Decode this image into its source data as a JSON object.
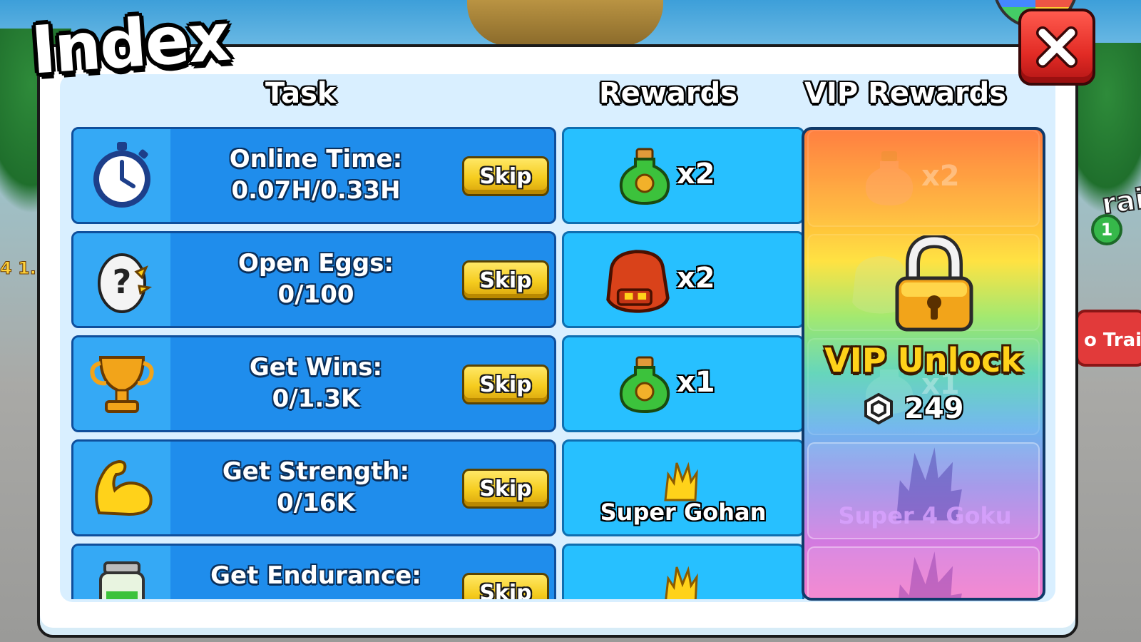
{
  "window": {
    "title": "Index",
    "close_icon": "close-x-icon"
  },
  "columns": {
    "task": "Task",
    "rewards": "Rewards",
    "vip_rewards": "VIP Rewards"
  },
  "rows": [
    {
      "task_label": "Online Time:",
      "task_value": "0.07H/0.33H",
      "task_icon": "stopwatch-icon",
      "skip_label": "Skip",
      "reward_icon": "potion-icon",
      "reward_text": "x2",
      "vip_icon": "potion-icon",
      "vip_text": "x2"
    },
    {
      "task_label": "Open Eggs:",
      "task_value": "0/100",
      "task_icon": "mystery-egg-icon",
      "skip_label": "Skip",
      "reward_icon": "backpack-icon",
      "reward_text": "x2",
      "vip_icon": "backpack-icon",
      "vip_text": ""
    },
    {
      "task_label": "Get Wins:",
      "task_value": "0/1.3K",
      "task_icon": "trophy-icon",
      "skip_label": "Skip",
      "reward_icon": "potion-icon",
      "reward_text": "x1",
      "vip_icon": "potion-icon",
      "vip_text": "x1"
    },
    {
      "task_label": "Get Strength:",
      "task_value": "0/16K",
      "task_icon": "flexed-arm-icon",
      "skip_label": "Skip",
      "reward_icon": "character-icon",
      "reward_text": "Super Gohan",
      "vip_icon": "character-icon",
      "vip_text": "Super 4 Goku"
    },
    {
      "task_label": "Get Endurance:",
      "task_value": "",
      "task_icon": "jar-icon",
      "skip_label": "Skip",
      "reward_icon": "character-icon",
      "reward_text": "",
      "vip_icon": "character-icon",
      "vip_text": ""
    }
  ],
  "vip_lock": {
    "lock_icon": "padlock-icon",
    "unlock_label": "VIP Unlock",
    "currency_icon": "robux-icon",
    "price": "249"
  },
  "background": {
    "left_text": "4 1.",
    "right_badge": "1",
    "right_button": "o Train",
    "right_text": "rai"
  },
  "colors": {
    "task_row": "#1f8dec",
    "reward_cell": "#27c0ff",
    "skip_button": "#f5cc1e",
    "close_button": "#e22b25",
    "vip_unlock_text": "#ffd21a"
  }
}
